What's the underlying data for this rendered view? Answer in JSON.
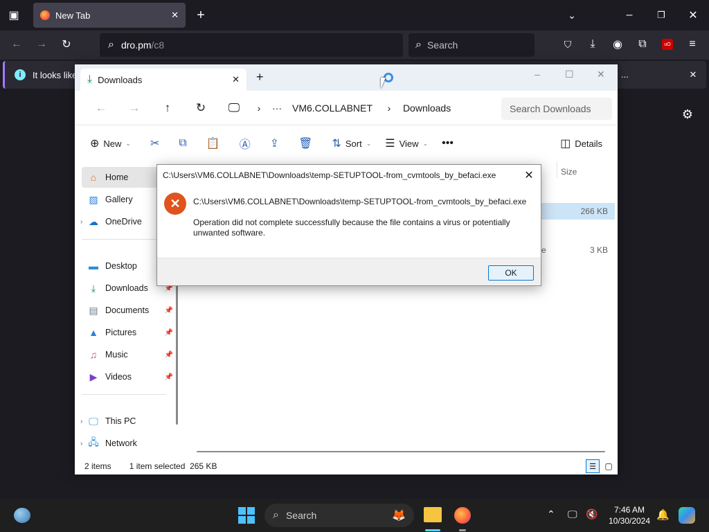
{
  "firefox": {
    "tab_title": "New Tab",
    "url_host": "dro.pm",
    "url_path": "/c8",
    "search_placeholder": "Search",
    "notification_text": "It looks like",
    "notification_more": "..."
  },
  "explorer": {
    "tab_label": "Downloads",
    "breadcrumb": [
      "VM6.COLLABNET",
      "Downloads"
    ],
    "search_placeholder": "Search Downloads",
    "commands": {
      "new": "New",
      "sort": "Sort",
      "view": "View",
      "details": "Details"
    },
    "sidebar": {
      "items": [
        {
          "label": "Home",
          "icon": "home-icon"
        },
        {
          "label": "Gallery",
          "icon": "gallery-icon"
        },
        {
          "label": "OneDrive",
          "icon": "cloud-icon"
        },
        {
          "label": "Desktop",
          "icon": "desktop-icon"
        },
        {
          "label": "Downloads",
          "icon": "download-icon"
        },
        {
          "label": "Documents",
          "icon": "documents-icon"
        },
        {
          "label": "Pictures",
          "icon": "pictures-icon"
        },
        {
          "label": "Music",
          "icon": "music-icon"
        },
        {
          "label": "Videos",
          "icon": "videos-icon"
        },
        {
          "label": "This PC",
          "icon": "computer-icon"
        },
        {
          "label": "Network",
          "icon": "network-icon"
        }
      ]
    },
    "column_size": "Size",
    "files": [
      {
        "size": "266 KB",
        "type_fragment": ""
      },
      {
        "size": "3 KB",
        "type_fragment": "e"
      }
    ],
    "status": {
      "items": "2 items",
      "selected": "1 item selected",
      "selected_size": "265 KB"
    }
  },
  "dialog": {
    "title": "C:\\Users\\VM6.COLLABNET\\Downloads\\temp-SETUPTOOL-from_cvmtools_by_befaci.exe",
    "path": "C:\\Users\\VM6.COLLABNET\\Downloads\\temp-SETUPTOOL-from_cvmtools_by_befaci.exe",
    "message": "Operation did not complete successfully because the file contains a virus or potentially unwanted software.",
    "ok_label": "OK"
  },
  "taskbar": {
    "search_placeholder": "Search",
    "time": "7:46 AM",
    "date": "10/30/2024"
  }
}
